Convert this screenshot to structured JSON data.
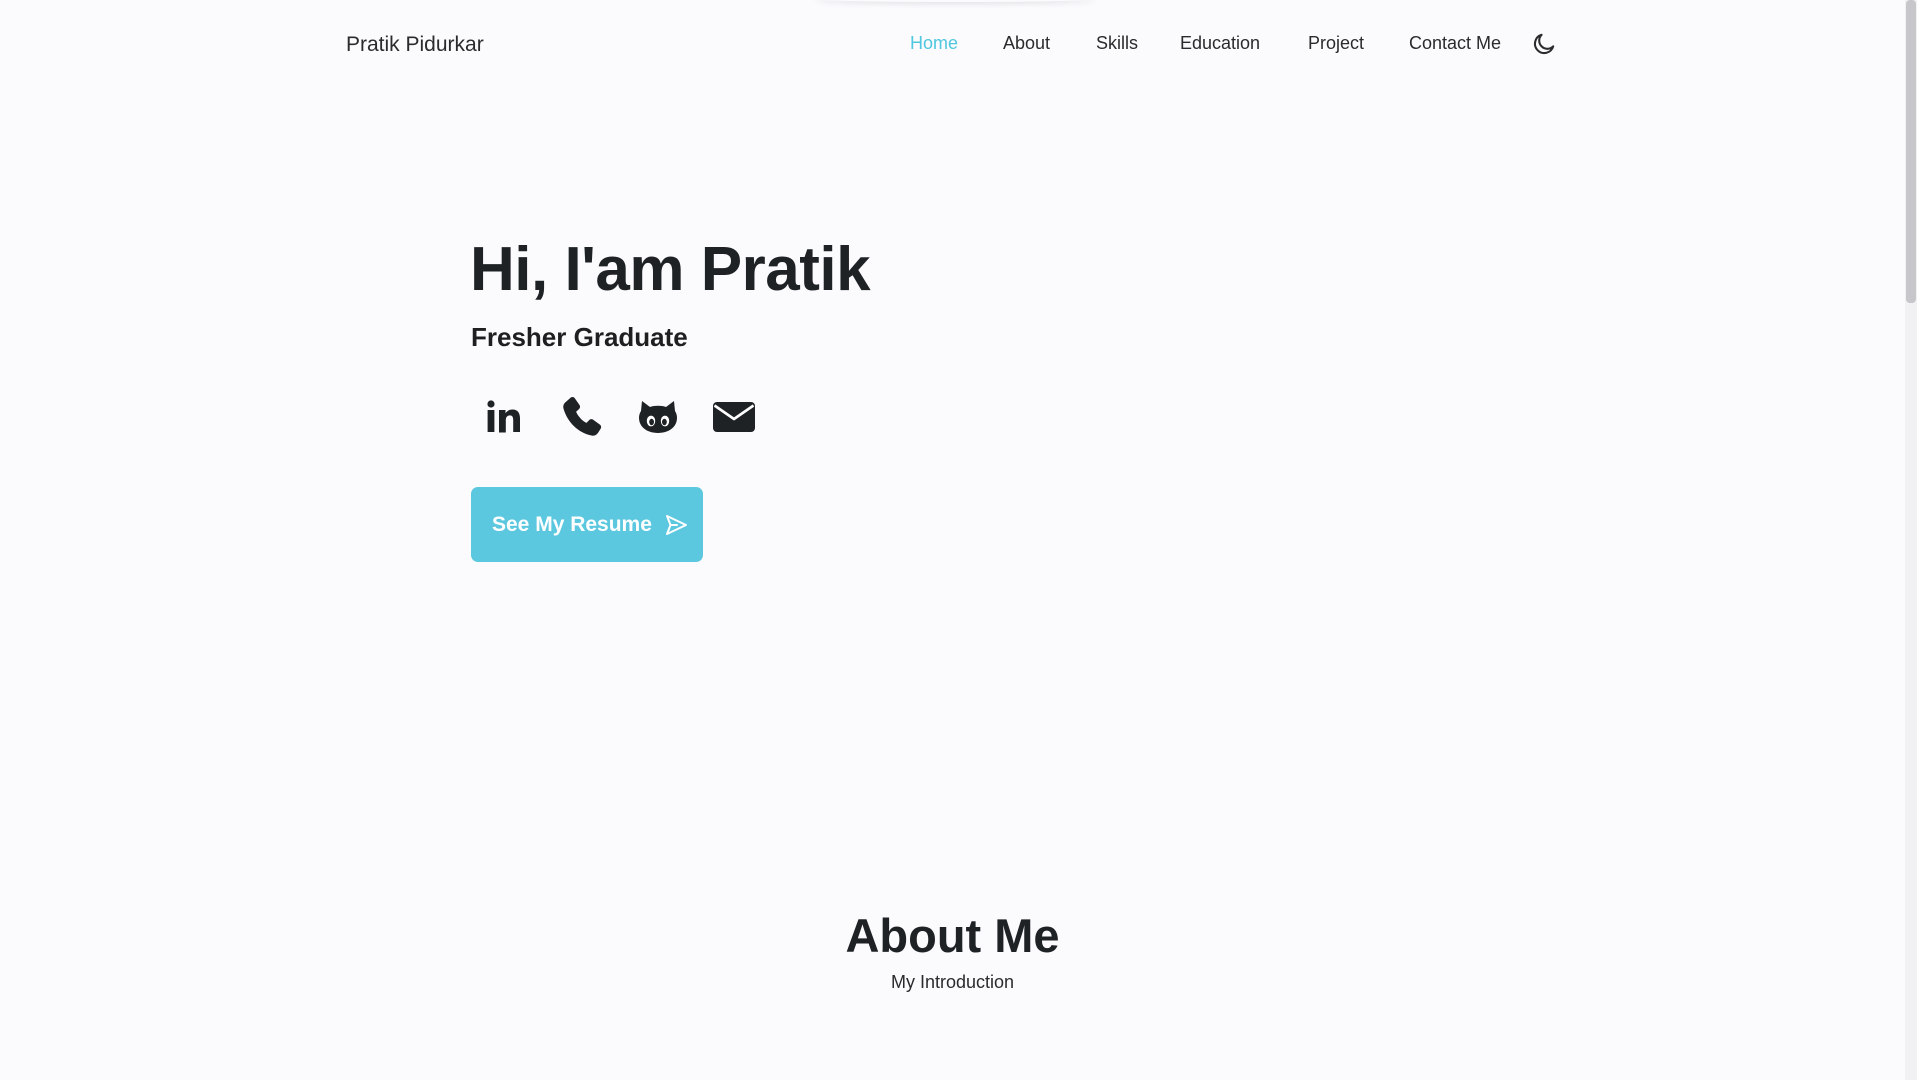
{
  "header": {
    "logo": "Pratik Pidurkar",
    "nav": [
      {
        "label": "Home",
        "active": true
      },
      {
        "label": "About",
        "active": false
      },
      {
        "label": "Skills",
        "active": false
      },
      {
        "label": "Education",
        "active": false
      },
      {
        "label": "Project",
        "active": false
      },
      {
        "label": "Contact Me",
        "active": false
      }
    ],
    "theme_toggle_icon": "moon-icon"
  },
  "hero": {
    "title": "Hi, I'am Pratik",
    "subtitle": "Fresher Graduate",
    "social_icons": [
      "linkedin-icon",
      "phone-icon",
      "github-icon",
      "email-icon"
    ],
    "cta_label": "See My Resume",
    "cta_icon": "send-icon"
  },
  "about": {
    "title": "About Me",
    "subtitle": "My Introduction"
  },
  "colors": {
    "accent": "#4ec7df",
    "button": "#5cc8df",
    "background": "#fbfbfe",
    "text": "#1f2225"
  }
}
